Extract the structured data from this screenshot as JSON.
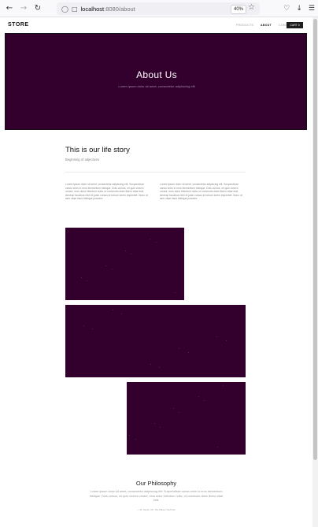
{
  "browser": {
    "url_host": "localhost",
    "url_rest": ":8080/about",
    "zoom": "40%"
  },
  "header": {
    "logo": "STORE",
    "nav": [
      "PRODUCTS",
      "ABOUT",
      "CONTACT"
    ],
    "active_nav": "ABOUT",
    "cart_label": "CART 0"
  },
  "hero": {
    "title": "About Us",
    "subtitle": "Lorem ipsum dolor sit amet, consectetur adipisicing elit"
  },
  "story": {
    "title": "This is our life story",
    "subtitle": "Beginning of adjectives",
    "para_left": "Lorem ipsum dolor sit amet, consectetur adipiscing elit. Suspendisse varius enim in eros elementum tristique. Duis cursus, mi quis viverra ornare, eros dolor interdum nulla, ut commodo diam libero vitae erat. Aenean faucibus nibh et justo cursus id rutrum lorem imperdiet. Nunc ut sem vitae risus tristique posuere.",
    "para_right": "Lorem ipsum dolor sit amet, consectetur adipiscing elit. Suspendisse varius enim in eros elementum tristique. Duis cursus, mi quis viverra ornare, eros dolor interdum nulla, ut commodo diam libero vitae erat. Aenean faucibus nibh et justo cursus id rutrum lorem imperdiet. Nunc ut sem vitae risus tristique posuere."
  },
  "philosophy": {
    "title": "Our Philosophy",
    "text": "Lorem ipsum dolor sit amet, consectetur adipiscing elit. Suspendisse varius enim in eros elementum tristique. Duis cursus, mi quis viverra ornare, eros dolor interdum nulla, ut commodo diam libero vitae erat.",
    "cite": "— Dr. Seuss, Oh, The Places You'll Go!"
  },
  "colors": {
    "hero_bg": "#33002e",
    "image_bg": "#33002e",
    "cart_bg": "#1d1d1d"
  }
}
